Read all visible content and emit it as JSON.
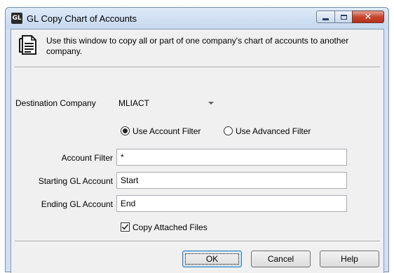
{
  "window": {
    "icon_text": "GL",
    "title": "GL Copy Chart of Accounts",
    "minimize_glyph": "",
    "close_glyph": "✕"
  },
  "info": {
    "text": "Use this window to copy all or part of one company's chart of accounts to another company."
  },
  "destination": {
    "label": "Destination Company",
    "value": "MLIACT"
  },
  "filter_mode": {
    "account_filter_label": "Use Account Filter",
    "advanced_filter_label": "Use Advanced Filter",
    "selected": "account"
  },
  "fields": {
    "account_filter_label": "Account Filter",
    "account_filter_value": "*",
    "starting_label": "Starting GL Account",
    "starting_value": "Start",
    "ending_label": "Ending GL Account",
    "ending_value": "End"
  },
  "copy_files": {
    "label": "Copy Attached Files",
    "checked": true
  },
  "buttons": {
    "ok": "OK",
    "cancel": "Cancel",
    "help": "Help"
  }
}
